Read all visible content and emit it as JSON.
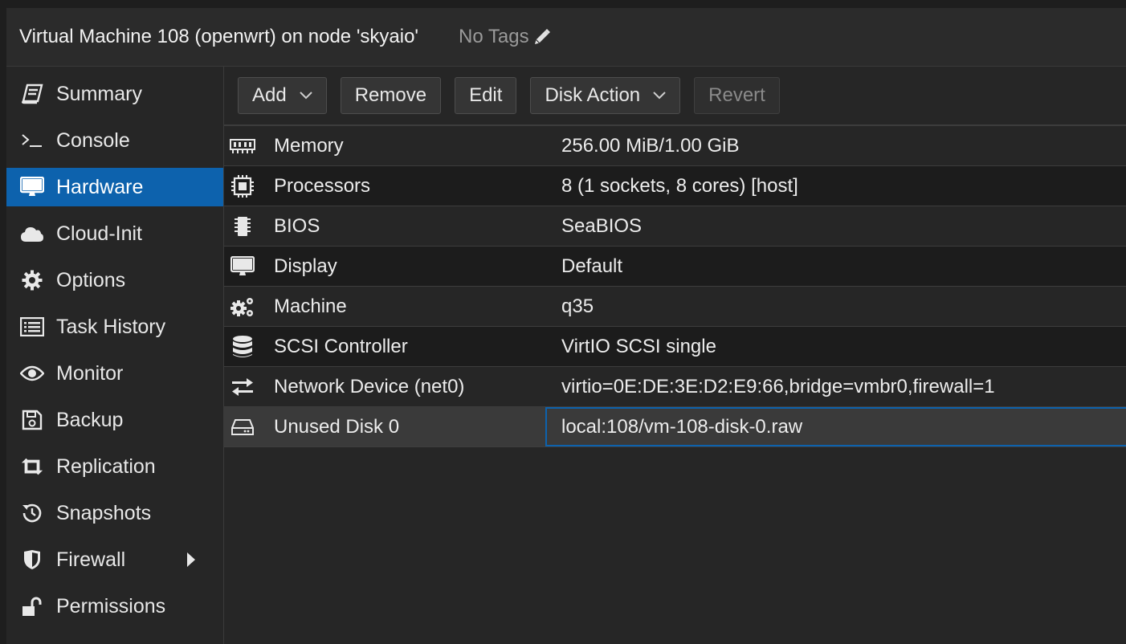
{
  "header": {
    "title": "Virtual Machine 108 (openwrt) on node 'skyaio'",
    "tags": "No Tags",
    "tags_icon": "pencil-icon"
  },
  "sidebar": {
    "items": [
      {
        "label": "Summary",
        "icon": "book-icon",
        "active": false
      },
      {
        "label": "Console",
        "icon": "terminal-icon",
        "active": false
      },
      {
        "label": "Hardware",
        "icon": "monitor-icon",
        "active": true
      },
      {
        "label": "Cloud-Init",
        "icon": "cloud-icon",
        "active": false
      },
      {
        "label": "Options",
        "icon": "gear-icon",
        "active": false
      },
      {
        "label": "Task History",
        "icon": "list-icon",
        "active": false
      },
      {
        "label": "Monitor",
        "icon": "eye-icon",
        "active": false
      },
      {
        "label": "Backup",
        "icon": "floppy-icon",
        "active": false
      },
      {
        "label": "Replication",
        "icon": "retweet-icon",
        "active": false
      },
      {
        "label": "Snapshots",
        "icon": "history-icon",
        "active": false
      },
      {
        "label": "Firewall",
        "icon": "shield-icon",
        "active": false,
        "has_submenu": true
      },
      {
        "label": "Permissions",
        "icon": "unlock-icon",
        "active": false
      }
    ]
  },
  "toolbar": {
    "add_label": "Add",
    "remove_label": "Remove",
    "edit_label": "Edit",
    "disk_action_label": "Disk Action",
    "revert_label": "Revert"
  },
  "hardware": {
    "rows": [
      {
        "name": "Memory",
        "value": "256.00 MiB/1.00 GiB",
        "icon": "memory-icon"
      },
      {
        "name": "Processors",
        "value": "8 (1 sockets, 8 cores) [host]",
        "icon": "cpu-icon"
      },
      {
        "name": "BIOS",
        "value": "SeaBIOS",
        "icon": "microchip-icon"
      },
      {
        "name": "Display",
        "value": "Default",
        "icon": "desktop-icon"
      },
      {
        "name": "Machine",
        "value": "q35",
        "icon": "cogs-icon"
      },
      {
        "name": "SCSI Controller",
        "value": "VirtIO SCSI single",
        "icon": "database-icon"
      },
      {
        "name": "Network Device (net0)",
        "value": "virtio=0E:DE:3E:D2:E9:66,bridge=vmbr0,firewall=1",
        "icon": "exchange-icon"
      },
      {
        "name": "Unused Disk 0",
        "value": "local:108/vm-108-disk-0.raw",
        "icon": "hdd-icon",
        "selected": true
      }
    ]
  },
  "colors": {
    "accent": "#0d62ad",
    "background": "#262626",
    "header": "#2b2b2b",
    "alt_row": "#1c1c1c",
    "selected_row": "#3a3a3a"
  }
}
